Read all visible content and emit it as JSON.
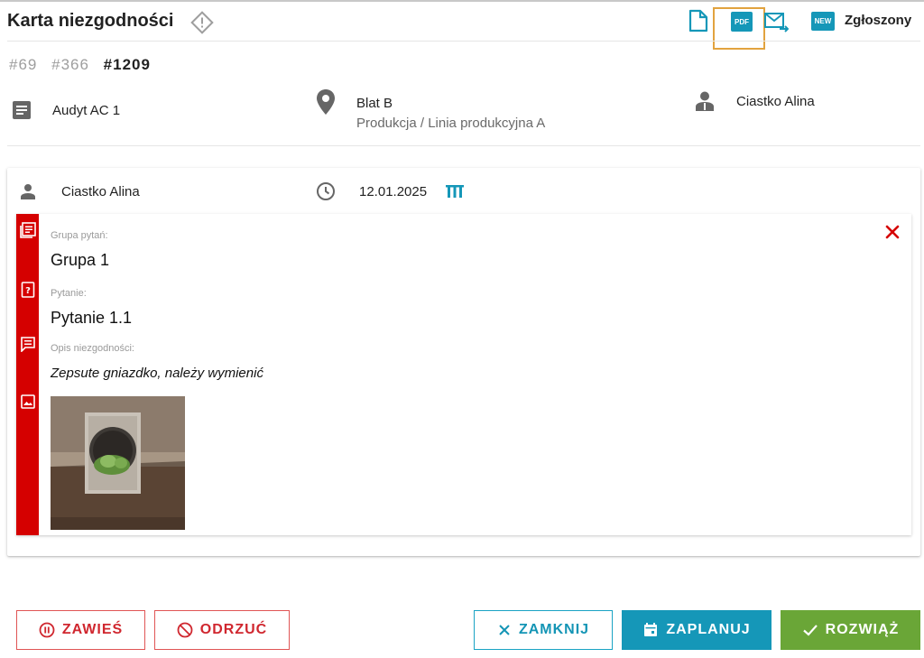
{
  "header": {
    "title": "Karta niezgodności",
    "pdf_label": "PDF",
    "new_badge": "NEW",
    "status": "Zgłoszony"
  },
  "ids": {
    "prev1": "#69",
    "prev2": "#366",
    "current": "#1209"
  },
  "info": {
    "audit": "Audyt AC 1",
    "location": "Blat B",
    "location_path": "Produkcja / Linia produkcyjna A",
    "assignee": "Ciastko Alina"
  },
  "entry": {
    "author": "Ciastko Alina",
    "date": "12.01.2025",
    "group_label": "Grupa pytań:",
    "group_value": "Grupa 1",
    "question_label": "Pytanie:",
    "question_value": "Pytanie 1.1",
    "desc_label": "Opis niezgodności:",
    "desc_value": "Zepsute gniazdko, należy wymienić"
  },
  "actions": {
    "suspend": "ZAWIEŚ",
    "reject": "ODRZUĆ",
    "close": "ZAMKNIJ",
    "schedule": "ZAPLANUJ",
    "resolve": "ROZWIĄŻ"
  },
  "colors": {
    "accent": "#1597b8",
    "danger": "#d50000",
    "success": "#6aa637",
    "highlight": "#e2a33f"
  }
}
